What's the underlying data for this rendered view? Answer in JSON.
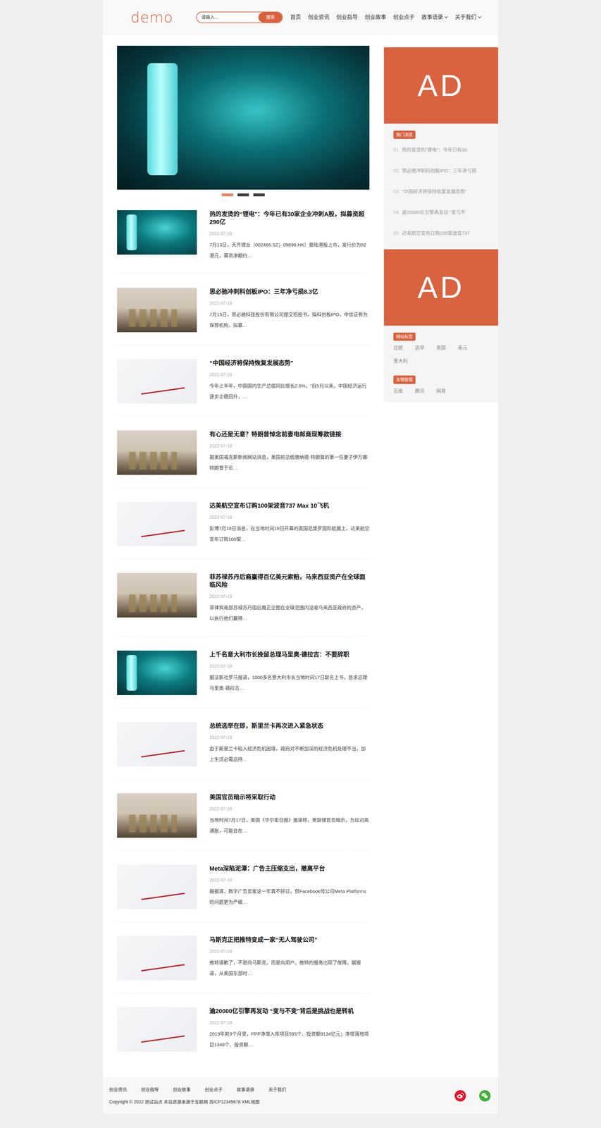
{
  "header": {
    "logo": "demo",
    "search": {
      "placeholder": "请输入...",
      "button": "搜索"
    },
    "nav": [
      {
        "label": "首页",
        "dropdown": false
      },
      {
        "label": "创业资讯",
        "dropdown": false
      },
      {
        "label": "创业指导",
        "dropdown": false
      },
      {
        "label": "创业故事",
        "dropdown": false
      },
      {
        "label": "创业点子",
        "dropdown": false
      },
      {
        "label": "故事语录",
        "dropdown": true
      },
      {
        "label": "关于我们",
        "dropdown": true
      }
    ]
  },
  "carousel": {
    "indicators": [
      {
        "selected": true
      },
      {
        "selected": false
      },
      {
        "selected": false
      }
    ]
  },
  "articles": [
    {
      "title": "热的发烫的“锂电”：今年已有30家企业冲刺A股，拟募资超290亿",
      "date": "2022-07-18",
      "excerpt": "7月13日，天齐锂业（002466.SZ；09696.HK）登陆港股上市，发行价为82港元，募资净额约…",
      "thumb": "battery"
    },
    {
      "title": "思必驰冲刺科创板IPO：三年净亏损8.3亿",
      "date": "2022-07-18",
      "excerpt": "7月15日，思必驰科技股份有限公司提交招股书，拟科创板IPO，中信证券为保荐机构，拟募…",
      "thumb": "coins"
    },
    {
      "title": "“中国经济将保持恢复发展态势”",
      "date": "2022-07-18",
      "excerpt": "今年上半年，中国国内生产总值同比增长2.5%，“自5月以来，中国经济运行逐步企稳回升，…",
      "thumb": "startup"
    },
    {
      "title": "有心还是无意？特朗普悼念前妻电邮竟现筹款链接",
      "date": "2022-07-18",
      "excerpt": "据美国福克斯新闻网站消息，美国前总统唐纳德·特朗普的第一任妻子伊万娜·特朗普于近…",
      "thumb": "coins"
    },
    {
      "title": "达美航空宣布订购100架波音737 Max 10飞机",
      "date": "2022-07-18",
      "excerpt": "彭博7月18日消息，在当地时间18日开幕的英国范堡罗国际航展上，达美航空宣布订购100架…",
      "thumb": "startup"
    },
    {
      "title": "菲苏禄苏丹后裔赢得百亿美元索赔，马来西亚资产在全球面临风险",
      "date": "2022-07-18",
      "excerpt": "菲律宾南部苏禄苏丹国后裔正企图在全球范围内没收马来西亚政府的资产，以执行他们赢得…",
      "thumb": "coins"
    },
    {
      "title": "上千名意大利市长挽留总理马里奥·德拉吉：不要辞职",
      "date": "2022-07-18",
      "excerpt": "据法新社罗马报道，1000多名意大利市长当地时间17日联名上书，恳求总理马里奥·德拉吉…",
      "thumb": "battery"
    },
    {
      "title": "总统选举在即，斯里兰卡再次进入紧急状态",
      "date": "2022-07-18",
      "excerpt": "由于斯里兰卡陷入经济危机困境，政府对不断加深的经济危机处理不当，加上生活必需品持…",
      "thumb": "startup"
    },
    {
      "title": "美国官员暗示将采取行动",
      "date": "2022-07-18",
      "excerpt": "当地时间7月17日，美国《华尔街日报》报道称，美联储官员暗示，为应对高通胀，可能会在…",
      "thumb": "coins"
    },
    {
      "title": "Meta深陷泥潭：广告主压缩支出，撤离平台",
      "date": "2022-07-18",
      "excerpt": "据报道，数字广告卖家这一年真不好过，但Facebook母公司Meta Platforms的问题更为严峻…",
      "thumb": "startup"
    },
    {
      "title": "马斯克正把推特变成一家“无人驾驶公司”",
      "date": "2022-07-18",
      "excerpt": "推特道歉了，不是向马斯克，而是向用户。推特的服务出现了故障。据报道，从美国东部时…",
      "thumb": "startup"
    },
    {
      "title": "逾20000亿引擎再发动 “变与不变”背后是挑战也是转机",
      "date": "2022-07-18",
      "excerpt": "2019年前9个月里，PPP净增入库项目595个、投资额9134亿元；净增落地项目1348个、投资额…",
      "thumb": "startup"
    }
  ],
  "sidebar": {
    "ads": [
      "AD",
      "AD"
    ],
    "hot": {
      "title": "热门浏览",
      "items": [
        {
          "num": "01.",
          "text": "热的发烫的“锂电”：今年已有30"
        },
        {
          "num": "02.",
          "text": "思必驰冲刺科创板IPO：三年净亏损"
        },
        {
          "num": "03.",
          "text": "“中国经济将保持恢复发展态势”"
        },
        {
          "num": "04.",
          "text": "逾20000亿引擎再发动 “变与不"
        },
        {
          "num": "05.",
          "text": "达美航空宣布订购100架波音737"
        }
      ]
    },
    "tags": {
      "title": "网站标签",
      "items": [
        "总统",
        "选举",
        "美国",
        "美元",
        "意大利"
      ]
    },
    "links": {
      "title": "友情链接",
      "items": [
        "百度",
        "腾讯",
        "网易"
      ]
    }
  },
  "footer": {
    "links": [
      "创业资讯",
      "创业指导",
      "创业故事",
      "创业点子",
      "故事语录",
      "关于我们"
    ],
    "copyright": "Copyright © 2022 测试站点 本站资源来源于互联网 苏ICP12345678 XML地图"
  }
}
